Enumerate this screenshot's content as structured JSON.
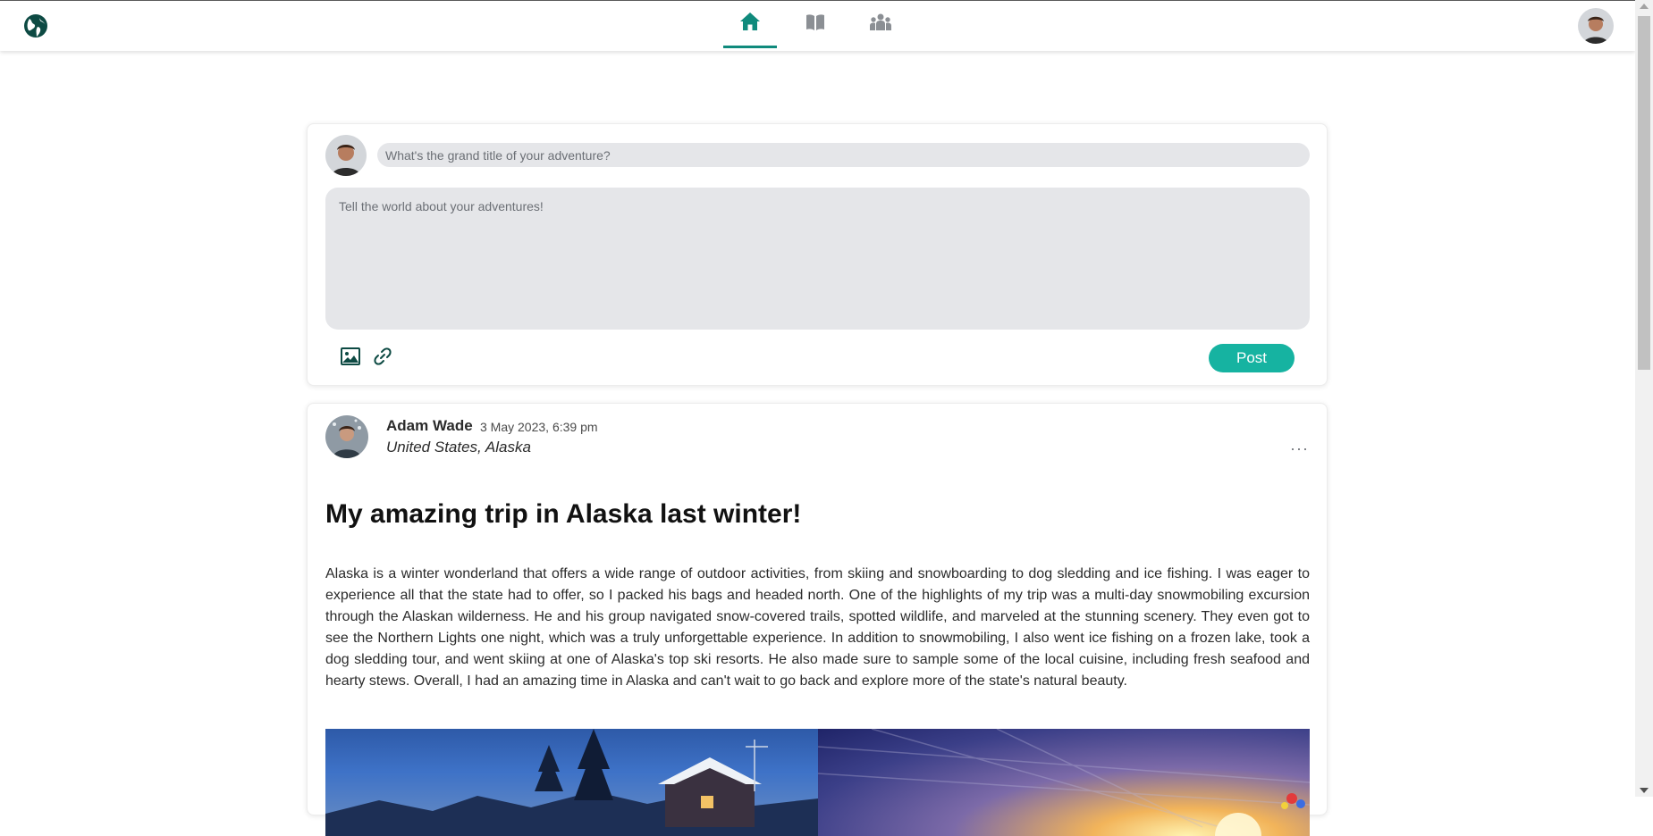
{
  "nav": {
    "logo_icon": "globe-icon",
    "tabs": [
      {
        "name": "home",
        "icon": "home-icon",
        "active": true
      },
      {
        "name": "journal",
        "icon": "book-open-icon",
        "active": false
      },
      {
        "name": "community",
        "icon": "users-icon",
        "active": false
      }
    ],
    "accent_color": "#0f8a7c",
    "inactive_color": "#8b8f94"
  },
  "composer": {
    "title_placeholder": "What's the grand title of your adventure?",
    "body_placeholder": "Tell the world about your adventures!",
    "tools": [
      "image-icon",
      "link-icon"
    ],
    "post_label": "Post",
    "post_color": "#16b3a1"
  },
  "post": {
    "author": "Adam Wade",
    "date": "3 May 2023, 6:39 pm",
    "location": "United States, Alaska",
    "more_label": "···",
    "title": "My amazing trip in Alaska last winter!",
    "body": "Alaska is a winter wonderland that offers a wide range of outdoor activities, from skiing and snowboarding to dog sledding and ice fishing. I was eager to experience all that the state had to offer, so I packed his bags and headed north. One of the highlights of my trip was a multi-day snowmobiling excursion through the Alaskan wilderness. He and his group navigated snow-covered trails, spotted wildlife, and marveled at the stunning scenery. They even got to see the Northern Lights one night, which was a truly unforgettable experience. In addition to snowmobiling, I also went ice fishing on a frozen lake, took a dog sledding tour, and went skiing at one of Alaska's top ski resorts. He also made sure to sample some of the local cuisine, including fresh seafood and hearty stews. Overall, I had an amazing time in Alaska and can't wait to go back and explore more of the state's natural beauty."
  }
}
